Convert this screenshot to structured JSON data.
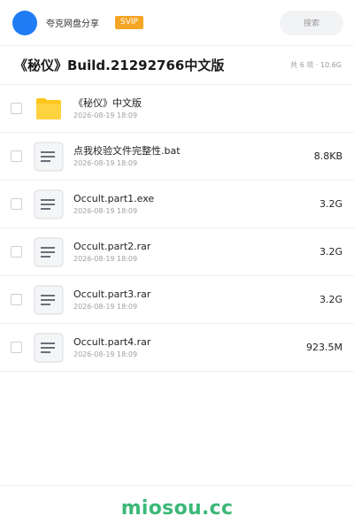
{
  "header": {
    "username": "夸克网盘分享",
    "badge": "SVIP",
    "search_placeholder": "搜索"
  },
  "folder": {
    "title": "《秘仪》Build.21292766中文版",
    "summary": "共 6 项 · 10.6G"
  },
  "files": [
    {
      "type": "folder",
      "name": "《秘仪》中文版",
      "date": "2026-08-19 18:09",
      "size": ""
    },
    {
      "type": "file",
      "name": "点我校验文件完整性.bat",
      "date": "2026-08-19 18:09",
      "size": "8.8KB"
    },
    {
      "type": "file",
      "name": "Occult.part1.exe",
      "date": "2026-08-19 18:09",
      "size": "3.2G"
    },
    {
      "type": "file",
      "name": "Occult.part2.rar",
      "date": "2026-08-19 18:09",
      "size": "3.2G"
    },
    {
      "type": "file",
      "name": "Occult.part3.rar",
      "date": "2026-08-19 18:09",
      "size": "3.2G"
    },
    {
      "type": "file",
      "name": "Occult.part4.rar",
      "date": "2026-08-19 18:09",
      "size": "923.5M"
    }
  ],
  "footer": {
    "brand": "miosou.cc"
  },
  "colors": {
    "avatar": "#1f7cf5",
    "svip_badge": "#f5a524",
    "folder_icon": "#ffc61a",
    "brand": "#3cb878"
  },
  "icons": {
    "folder": "folder-icon",
    "file": "document-icon"
  }
}
